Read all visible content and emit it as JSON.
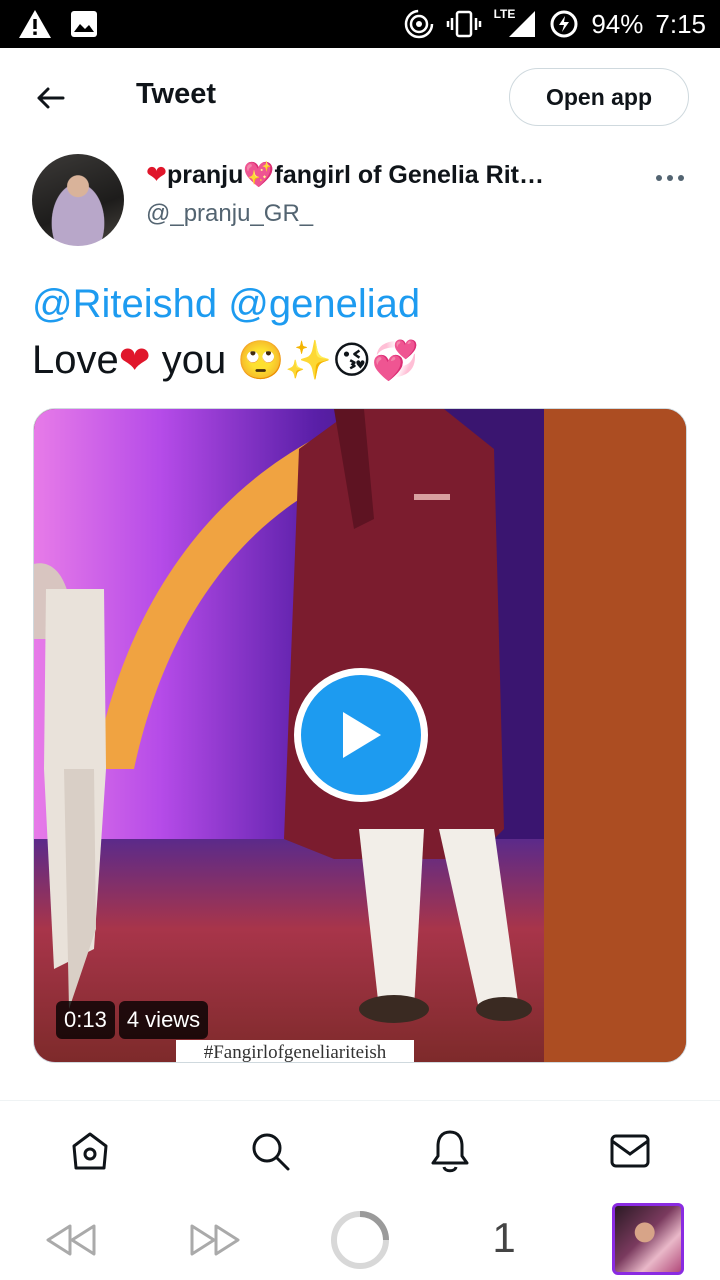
{
  "status_bar": {
    "battery": "94%",
    "time": "7:15",
    "network": "LTE"
  },
  "header": {
    "title": "Tweet",
    "open_app_label": "Open app"
  },
  "tweet": {
    "author": {
      "display_name_part1": "pranju",
      "display_name_part2": "fangirl of Genelia Rit…",
      "handle": "@_pranju_GR_"
    },
    "mentions": [
      "@Riteishd",
      "@geneliad"
    ],
    "text_word1": "Love",
    "text_word2": "you",
    "emojis": [
      "🙄",
      "✨",
      "😘",
      "💞"
    ],
    "video": {
      "duration": "0:13",
      "views": "4 views",
      "watermark": "#Fangirlofgeneliariteish"
    }
  },
  "bottom_nav": {
    "items": [
      "home-icon",
      "search-icon",
      "notifications-icon",
      "messages-icon"
    ]
  },
  "browser_bar": {
    "tab_count": "1"
  },
  "colors": {
    "accent": "#1d9bf0",
    "text": "#0f1419",
    "secondary": "#536471",
    "border": "#cfd9de"
  }
}
